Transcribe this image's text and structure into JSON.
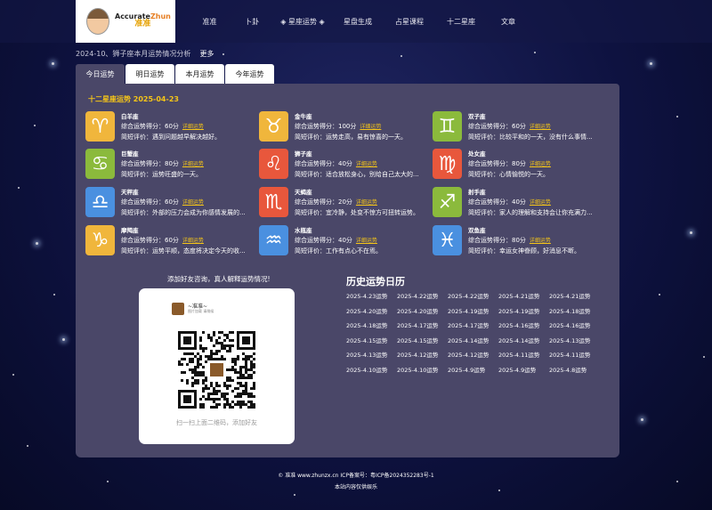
{
  "logo": {
    "text_en_a": "Accurate",
    "text_en_b": "Zhun",
    "text_cn": "准准"
  },
  "nav": [
    {
      "label": "准准"
    },
    {
      "label": "卜卦"
    },
    {
      "label": "◈ 星座运势 ◈"
    },
    {
      "label": "星盘生成"
    },
    {
      "label": "占星课程"
    },
    {
      "label": "十二星座"
    },
    {
      "label": "文章"
    }
  ],
  "news": {
    "text": "2024-10、狮子座本月运势情况分析",
    "more": "更多"
  },
  "tabs": [
    {
      "label": "今日运势",
      "active": true
    },
    {
      "label": "明日运势",
      "active": false
    },
    {
      "label": "本月运势",
      "active": false
    },
    {
      "label": "今年运势",
      "active": false
    }
  ],
  "panel": {
    "title": "十二星座运势 2025-04-23"
  },
  "signs": [
    {
      "name": "白羊座",
      "glyph": "♈",
      "color": "#f0b63c",
      "score": "综合运势得分：60分",
      "detail": "详细运势",
      "brief": "简短评价：遇到问题越早解决越好。"
    },
    {
      "name": "金牛座",
      "glyph": "♉",
      "color": "#f0b63c",
      "score": "综合运势得分：100分",
      "detail": "详细运势",
      "brief": "简短评价：运势走高，易有惊喜的一天。"
    },
    {
      "name": "双子座",
      "glyph": "♊",
      "color": "#8bba3c",
      "score": "综合运势得分：60分",
      "detail": "详细运势",
      "brief": "简短评价：比较平和的一天，没有什么事情..."
    },
    {
      "name": "巨蟹座",
      "glyph": "♋",
      "color": "#8bba3c",
      "score": "综合运势得分：80分",
      "detail": "详细运势",
      "brief": "简短评价：运势旺盛的一天。"
    },
    {
      "name": "狮子座",
      "glyph": "♌",
      "color": "#e8573c",
      "score": "综合运势得分：40分",
      "detail": "详细运势",
      "brief": "简短评价：适合放松身心，别给自己太大的..."
    },
    {
      "name": "处女座",
      "glyph": "♍",
      "color": "#e8573c",
      "score": "综合运势得分：80分",
      "detail": "详细运势",
      "brief": "简短评价：心情愉悦的一天。"
    },
    {
      "name": "天秤座",
      "glyph": "♎",
      "color": "#4a90e0",
      "score": "综合运势得分：60分",
      "detail": "详细运势",
      "brief": "简短评价：外部的压力会成为你感情发展的..."
    },
    {
      "name": "天蝎座",
      "glyph": "♏",
      "color": "#e8573c",
      "score": "综合运势得分：20分",
      "detail": "详细运势",
      "brief": "简短评价：宜冷静，处变不惊方可扭转运势。"
    },
    {
      "name": "射手座",
      "glyph": "♐",
      "color": "#8bba3c",
      "score": "综合运势得分：40分",
      "detail": "详细运势",
      "brief": "简短评价：家人的理解和支持会让你充满力..."
    },
    {
      "name": "摩羯座",
      "glyph": "♑",
      "color": "#f0b63c",
      "score": "综合运势得分：60分",
      "detail": "详细运势",
      "brief": "简短评价：运势平顺，态度将决定今天的收..."
    },
    {
      "name": "水瓶座",
      "glyph": "♒",
      "color": "#4a90e0",
      "score": "综合运势得分：40分",
      "detail": "详细运势",
      "brief": "简短评价：工作有点心不在焉。"
    },
    {
      "name": "双鱼座",
      "glyph": "♓",
      "color": "#4a90e0",
      "score": "综合运势得分：80分",
      "detail": "详细运势",
      "brief": "简短评价：幸运女神眷顾，好消息不断。"
    }
  ],
  "qr": {
    "caption": "添加好友咨询，真人解释运势情况!",
    "name": "~准准~",
    "sub": "图片加载 请稍候",
    "footer": "扫一扫上面二维码，添加好友"
  },
  "history": {
    "title": "历史运势日历",
    "links": [
      "2025-4.23运势",
      "2025-4.22运势",
      "2025-4.22运势",
      "2025-4.21运势",
      "2025-4.21运势",
      "2025-4.20运势",
      "2025-4.20运势",
      "2025-4.19运势",
      "2025-4.19运势",
      "2025-4.18运势",
      "2025-4.18运势",
      "2025-4.17运势",
      "2025-4.17运势",
      "2025-4.16运势",
      "2025-4.16运势",
      "2025-4.15运势",
      "2025-4.15运势",
      "2025-4.14运势",
      "2025-4.14运势",
      "2025-4.13运势",
      "2025-4.13运势",
      "2025-4.12运势",
      "2025-4.12运势",
      "2025-4.11运势",
      "2025-4.11运势",
      "2025-4.10运势",
      "2025-4.10运势",
      "2025-4.9运势",
      "2025-4.9运势",
      "2025-4.8运势"
    ]
  },
  "footer": {
    "line1": "© 准准 www.zhunzx.cn    ICP备案号：粤ICP备2024352283号-1",
    "line2": "本站内容仅供娱乐"
  }
}
